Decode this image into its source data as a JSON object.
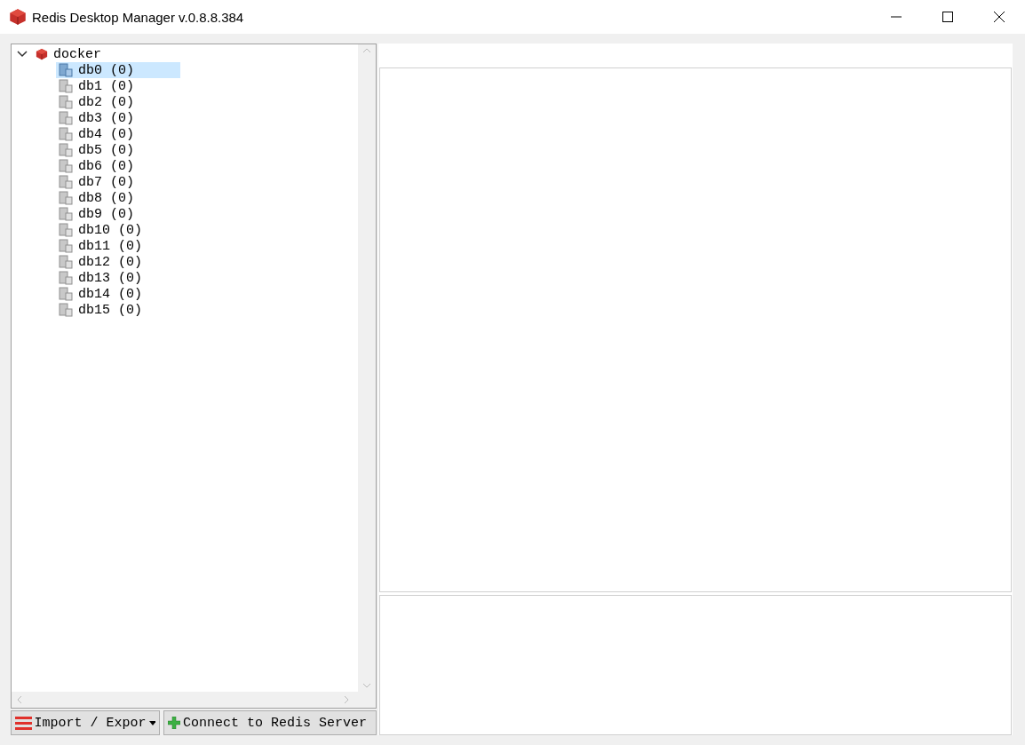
{
  "window": {
    "title": "Redis Desktop Manager v.0.8.8.384"
  },
  "tree": [
    {
      "label": "docker",
      "expanded": true,
      "children": [
        {
          "label": "db0 (0)",
          "selected": true
        },
        {
          "label": "db1 (0)",
          "selected": false
        },
        {
          "label": "db2 (0)",
          "selected": false
        },
        {
          "label": "db3 (0)",
          "selected": false
        },
        {
          "label": "db4 (0)",
          "selected": false
        },
        {
          "label": "db5 (0)",
          "selected": false
        },
        {
          "label": "db6 (0)",
          "selected": false
        },
        {
          "label": "db7 (0)",
          "selected": false
        },
        {
          "label": "db8 (0)",
          "selected": false
        },
        {
          "label": "db9 (0)",
          "selected": false
        },
        {
          "label": "db10 (0)",
          "selected": false
        },
        {
          "label": "db11 (0)",
          "selected": false
        },
        {
          "label": "db12 (0)",
          "selected": false
        },
        {
          "label": "db13 (0)",
          "selected": false
        },
        {
          "label": "db14 (0)",
          "selected": false
        },
        {
          "label": "db15 (0)",
          "selected": false
        }
      ]
    }
  ],
  "buttons": [
    {
      "kind": "menu",
      "label": "Import / Expor"
    },
    {
      "kind": "add",
      "label": "Connect to Redis Server"
    }
  ]
}
